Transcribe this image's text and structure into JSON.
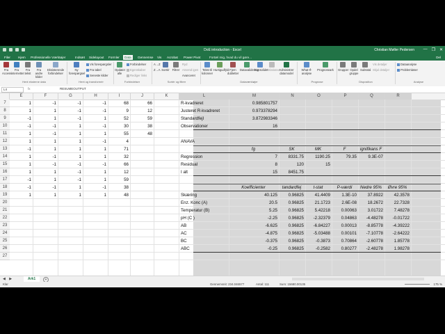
{
  "window": {
    "title": "DoE introduction - Excel",
    "user": "Christian Møller Pedersen",
    "controls": [
      "—",
      "❐",
      "✕"
    ]
  },
  "tabs": [
    "Filer",
    "Hjem",
    "Professionelle Værktøjer",
    "Indsæt",
    "Sidelayout",
    "Formler",
    "Data",
    "Gennemse",
    "Vis",
    "Acrobat",
    "Power Pivot"
  ],
  "active_tab": "Data",
  "tell_me": "Fortæl mig, hvad du vil gøre...",
  "share": "Del",
  "ribbon": {
    "groups": [
      "Hent eksterne data",
      "Hent og transformér",
      "Forbindelser",
      "Sortér og filtrer",
      "Dataværktøjer",
      "Prognose",
      "Disposition",
      "Analyse"
    ],
    "buttons": {
      "from_access": "Fra Access",
      "from_web": "Fra internettet",
      "from_text": "Fra tekst",
      "other_sources": "Fra andre kilder",
      "existing_connections": "Eksisterende forbindelser",
      "new_query": "Ny forespørgsel",
      "show_queries": "Vis forespørgsler",
      "from_table": "Fra tabel",
      "recent_sources": "Seneste kilder",
      "refresh_all": "Opdater alle",
      "connections": "Forbindelser",
      "properties": "Egenskaber",
      "edit_links": "Rediger links",
      "sort_az": "A→Z",
      "sort_za": "Z→A",
      "sort": "Sortér",
      "filter": "Filtrer",
      "clear": "Ryd",
      "reapply": "Anvend igen",
      "advanced": "Avanceret",
      "text_to_columns": "Tekst til kolonner",
      "flash_fill": "Hurtigudfyld",
      "remove_duplicates": "Fjern dubletter",
      "data_validation": "Datavalidering",
      "consolidate": "Konsolider",
      "relations": "Relationer",
      "manage_data_model": "Administrer datamodel",
      "what_if": "What-If-analyse",
      "forecast_sheet": "Prognoseark",
      "group": "Grupper",
      "ungroup": "Opdel gruppe",
      "subtotal": "Subtotal",
      "show_detail": "Vis detaljer",
      "hide_detail": "Skjul detaljer",
      "data_analysis": "Dataanalyse",
      "solver": "Problemløser"
    }
  },
  "formula_bar": {
    "name_box": "L4",
    "fx": "fx",
    "formula": "RESUMEOUTPUT"
  },
  "columns": [
    "E",
    "F",
    "G",
    "H",
    "I",
    "J",
    "K",
    "L",
    "M",
    "N",
    "O",
    "P",
    "Q",
    "R"
  ],
  "selected_columns": [
    "L",
    "M",
    "N",
    "O",
    "P",
    "Q",
    "R"
  ],
  "rows": [
    "7",
    "8",
    "9",
    "10",
    "11",
    "12",
    "13",
    "14",
    "15",
    "16",
    "17",
    "18",
    "19",
    "20",
    "21",
    "22",
    "23",
    "24",
    "25",
    "26",
    "27"
  ],
  "left_data": [
    [
      "1",
      "-1",
      "-1",
      "-1",
      "68",
      "66"
    ],
    [
      "1",
      "1",
      "-1",
      "-1",
      "9",
      "12"
    ],
    [
      "-1",
      "1",
      "-1",
      "1",
      "52",
      "59"
    ],
    [
      "-1",
      "-1",
      "1",
      "-1",
      "30",
      "38"
    ],
    [
      "1",
      "-1",
      "1",
      "1",
      "55",
      "48"
    ],
    [
      "1",
      "1",
      "1",
      "-1",
      "4",
      ""
    ],
    [
      "-1",
      "1",
      "1",
      "1",
      "71",
      ""
    ],
    [
      "1",
      "-1",
      "1",
      "1",
      "32",
      ""
    ],
    [
      "1",
      "-1",
      "-1",
      "-1",
      "66",
      ""
    ],
    [
      "1",
      "1",
      "-1",
      "1",
      "12",
      ""
    ],
    [
      "-1",
      "1",
      "-1",
      "1",
      "59",
      ""
    ],
    [
      "-1",
      "-1",
      "1",
      "-1",
      "38",
      ""
    ],
    [
      "1",
      "1",
      "1",
      "1",
      "48",
      ""
    ]
  ],
  "stats": {
    "r2_label": "R-kvadreret",
    "r2": "0.985801757",
    "adj_label": "Justeret R-kvadreret",
    "adj": "0.973378294",
    "se_label": "Standardfejl",
    "se": "3.872983346",
    "obs_label": "Observationer",
    "obs": "16"
  },
  "anova": {
    "title": "ANAVA",
    "headers": [
      "fg",
      "SK",
      "MK",
      "F",
      "ignifikans F"
    ],
    "rows": [
      [
        "Regression",
        "7",
        "8331.75",
        "1190.25",
        "79.35",
        "9.3E-07"
      ],
      [
        "Residual",
        "8",
        "120",
        "15",
        "",
        ""
      ],
      [
        "I alt",
        "15",
        "8451.75",
        "",
        "",
        ""
      ]
    ]
  },
  "coef": {
    "headers": [
      "Koefficienter",
      "tandardfej",
      "t-stat",
      "P-værdi",
      "Nedre 95%",
      "Øvre 95%",
      "ed"
    ],
    "rows": [
      [
        "Skæring",
        "40.125",
        "0.96825",
        "41.4409",
        "1.3E-10",
        "37.8922",
        "42.3578"
      ],
      [
        "Enz. Konc (A)",
        "20.5",
        "0.96825",
        "21.1723",
        "2.6E-08",
        "18.2672",
        "22.7328"
      ],
      [
        "Temperatur (B)",
        "5.25",
        "0.96825",
        "5.42218",
        "0.00063",
        "3.01722",
        "7.48278"
      ],
      [
        "pH (C )",
        "-2.25",
        "0.96825",
        "-2.32379",
        "0.04863",
        "-4.48278",
        "-0.01722"
      ],
      [
        "AB",
        "-6.625",
        "0.96825",
        "-6.84227",
        "0.00013",
        "-8.85778",
        "-4.39222"
      ],
      [
        "AC",
        "-4.875",
        "0.96825",
        "-5.03488",
        "0.00101",
        "-7.10778",
        "-2.64222"
      ],
      [
        "BC",
        "-0.375",
        "0.96825",
        "-0.3873",
        "0.70864",
        "-2.60778",
        "1.85778"
      ],
      [
        "ABC",
        "-0.25",
        "0.96825",
        "-0.2582",
        "0.80277",
        "-2.48278",
        "1.98278"
      ]
    ]
  },
  "sheet": {
    "name": "Ark1",
    "add": "+",
    "nav": "◀ ▶"
  },
  "status": {
    "ready": "Klar",
    "average": "Gennemsnit: 234.046577",
    "count": "Antal: 111",
    "sum": "Sum: 15680.00135",
    "zoom": "175 %"
  },
  "colors": {
    "brand": "#217346",
    "selection": "#d8d8d8"
  }
}
